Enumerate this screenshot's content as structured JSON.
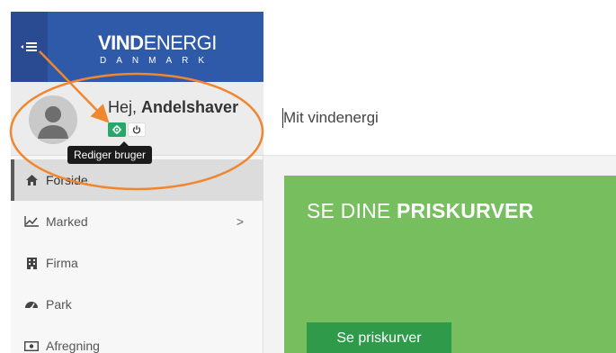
{
  "header": {
    "brand_bold": "VIND",
    "brand_light": "ENERGI",
    "brand_sub": "DANMARK",
    "menu_icon": "hamburger-icon"
  },
  "profile": {
    "greeting": "Hej,",
    "name": "Andelshaver",
    "edit_icon": "gear-icon",
    "logout_icon": "power-icon",
    "tooltip": "Rediger bruger"
  },
  "nav": {
    "items": [
      {
        "label": "Forside",
        "icon": "home-icon"
      },
      {
        "label": "Marked",
        "icon": "line-chart-icon",
        "chevron": ">"
      },
      {
        "label": "Firma",
        "icon": "building-icon"
      },
      {
        "label": "Park",
        "icon": "dashboard-icon"
      },
      {
        "label": "Afregning",
        "icon": "money-icon"
      }
    ]
  },
  "topbar": {
    "title": "Mit vindenergi"
  },
  "card": {
    "title_light": "SE DINE ",
    "title_bold": "PRISKURVER",
    "button_label": "Se priskurver"
  },
  "colors": {
    "brand_blue": "#2f5aaa",
    "menu_blue": "#2a4a92",
    "card_green": "#77bf5e",
    "button_green": "#2f9b4a",
    "annotation_orange": "#f0862d"
  }
}
